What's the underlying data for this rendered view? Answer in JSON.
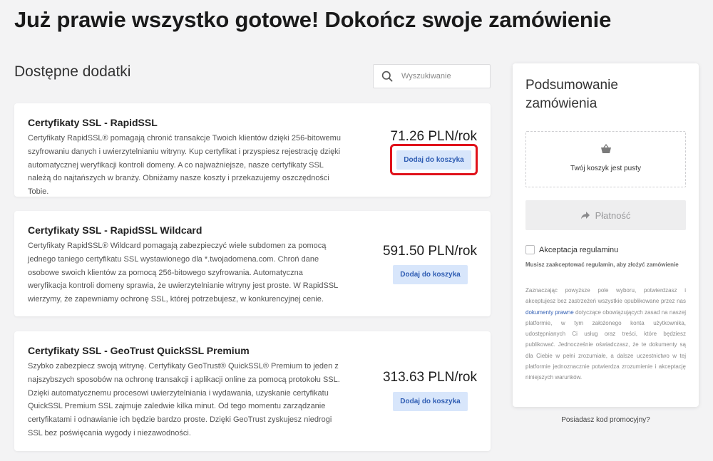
{
  "page": {
    "title": "Już prawie wszystko gotowe! Dokończ swoje zamówienie",
    "section_title": "Dostępne dodatki"
  },
  "search": {
    "placeholder": "Wyszukiwanie",
    "icon": "search-icon"
  },
  "products": [
    {
      "name": "Certyfikaty SSL - RapidSSL",
      "description": "Certyfikaty RapidSSL® pomagają chronić transakcje Twoich klientów dzięki 256-bitowemu szyfrowaniu danych i uwierzytelnianiu witryny. Kup certyfikat i przyspiesz rejestrację dzięki automatycznej weryfikacji kontroli domeny. A co najważniejsze, nasze certyfikaty SSL należą do najtańszych w branży. Obniżamy nasze koszty i przekazujemy oszczędności Tobie.",
      "price": "71.26 PLN/rok",
      "button": "Dodaj do koszyka",
      "highlighted": true
    },
    {
      "name": "Certyfikaty SSL - RapidSSL Wildcard",
      "description": "Certyfikaty RapidSSL® Wildcard pomagają zabezpieczyć wiele subdomen za pomocą jednego taniego certyfikatu SSL wystawionego dla *.twojadomena.com. Chroń dane osobowe swoich klientów za pomocą 256-bitowego szyfrowania. Automatyczna weryfikacja kontroli domeny sprawia, że uwierzytelnianie witryny jest proste. W RapidSSL wierzymy, że zapewniamy ochronę SSL, której potrzebujesz, w konkurencyjnej cenie.",
      "price": "591.50 PLN/rok",
      "button": "Dodaj do koszyka",
      "highlighted": false
    },
    {
      "name": "Certyfikaty SSL - GeoTrust QuickSSL Premium",
      "description": "Szybko zabezpiecz swoją witrynę. Certyfikaty GeoTrust® QuickSSL® Premium to jeden z najszybszych sposobów na ochronę transakcji i aplikacji online za pomocą protokołu SSL. Dzięki automatycznemu procesowi uwierzytelniania i wydawania, uzyskanie certyfikatu QuickSSL Premium SSL zajmuje zaledwie kilka minut. Od tego momentu zarządzanie certyfikatami i odnawianie ich będzie bardzo proste. Dzięki GeoTrust zyskujesz niedrogi SSL bez poświęcania wygody i niezawodności.",
      "price": "313.63 PLN/rok",
      "button": "Dodaj do koszyka",
      "highlighted": false
    }
  ],
  "summary": {
    "title": "Podsumowanie zamówienia",
    "cart_empty": "Twój koszyk jest pusty",
    "cart_icon": "basket-icon",
    "pay_button": "Płatność",
    "pay_icon": "share-arrow-icon",
    "accept_label": "Akceptacja regulaminu",
    "must_accept": "Musisz zaakceptować regulamin, aby złożyć zamówienie",
    "legal_before": "Zaznaczając powyższe pole wyboru, potwierdzasz i akceptujesz bez zastrzeżeń wszystkie opublikowane przez nas ",
    "legal_link": "dokumenty prawne",
    "legal_after": " dotyczące obowiązujących zasad na naszej platformie, w tym założonego konta użytkownika, udostępnianych Ci usług oraz treści, które będziesz publikować. Jednocześnie oświadczasz, że te dokumenty są dla Ciebie w pełni zrozumiałe, a dalsze uczestnictwo w tej platformie jednoznacznie potwierdza zrozumienie i akceptację niniejszych warunków."
  },
  "promo": "Posiadasz kod promocyjny?",
  "colors": {
    "background": "#f3f3f4",
    "button_bg": "#d8e6fb",
    "button_text": "#2f5db3",
    "highlight": "#e0121b",
    "link": "#2f5db3"
  }
}
